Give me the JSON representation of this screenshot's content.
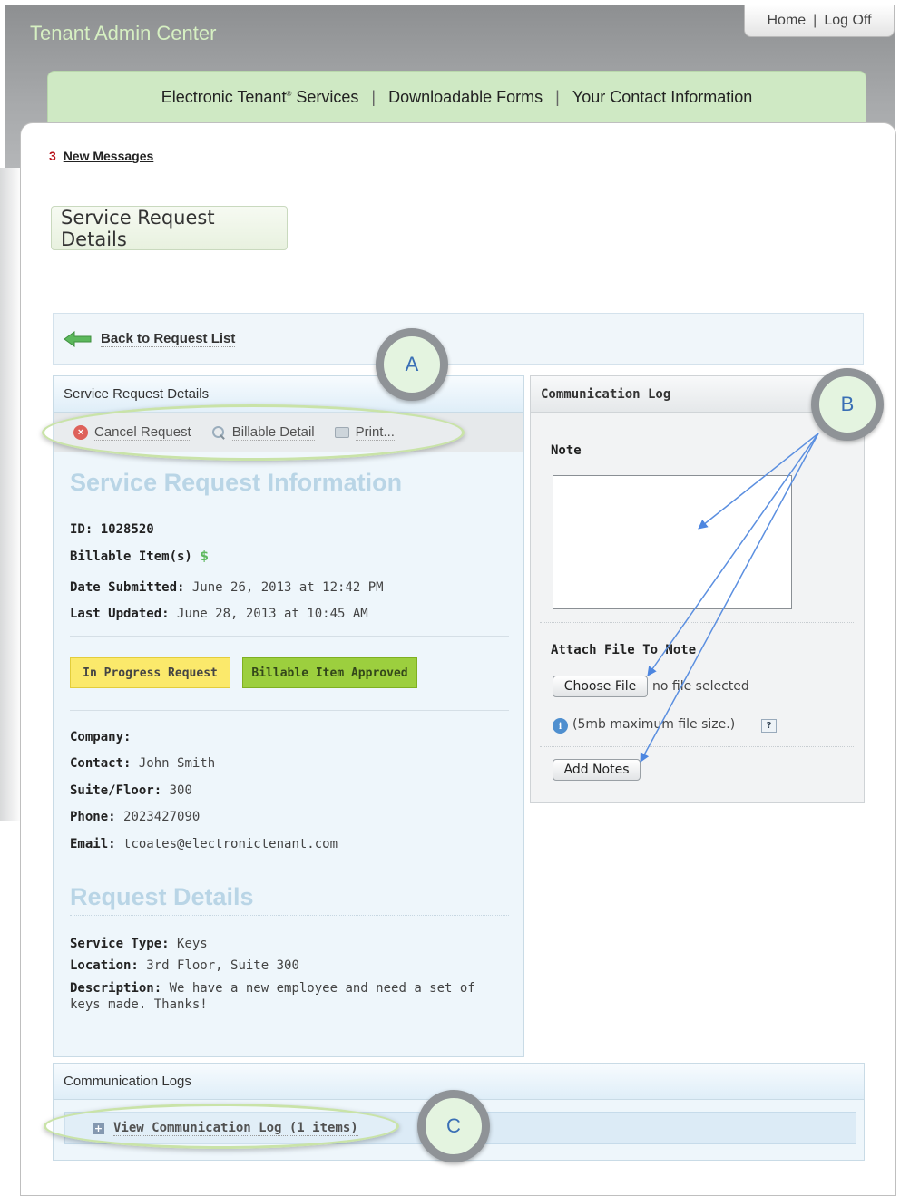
{
  "app": {
    "title": "Tenant Admin Center",
    "top_links": {
      "home": "Home",
      "separator": "|",
      "logoff": "Log Off"
    }
  },
  "nav": {
    "items": [
      {
        "label": "Electronic Tenant",
        "sup": "®",
        "suffix": " Services"
      },
      {
        "label": "Downloadable Forms"
      },
      {
        "label": "Your Contact Information"
      }
    ],
    "separator": "|"
  },
  "messages": {
    "count": "3",
    "label": "New Messages"
  },
  "page_title": "Service Request Details",
  "back_link": "Back to Request List",
  "left_panel": {
    "header": "Service Request Details",
    "toolbar": {
      "cancel": "Cancel Request",
      "billable": "Billable Detail",
      "print": "Print..."
    },
    "info_title": "Service Request Information",
    "id_label": "ID:",
    "id_value": "1028520",
    "billable_label": "Billable Item(s)",
    "billable_icon": "$",
    "submitted_label": "Date Submitted:",
    "submitted_value": "June 26, 2013 at 12:42 PM",
    "updated_label": "Last Updated:",
    "updated_value": "June 28, 2013 at 10:45 AM",
    "status_badge": "In Progress Request",
    "billable_badge": "Billable Item Approved",
    "company_label": "Company:",
    "company_value": "",
    "contact_label": "Contact:",
    "contact_value": "John Smith",
    "suite_label": "Suite/Floor:",
    "suite_value": "300",
    "phone_label": "Phone:",
    "phone_value": "2023427090",
    "email_label": "Email:",
    "email_value": "tcoates@electronictenant.com",
    "details_title": "Request Details",
    "service_type_label": "Service Type:",
    "service_type_value": "Keys",
    "location_label": "Location:",
    "location_value": "3rd Floor, Suite 300",
    "description_label": "Description:",
    "description_value": "We have a new employee and need a set of keys made. Thanks!"
  },
  "right_panel": {
    "header": "Communication Log",
    "note_label": "Note",
    "note_value": "",
    "attach_label": "Attach File To Note",
    "choose_file": "Choose File",
    "no_file": "no file selected",
    "info_icon": "i",
    "file_size": "(5mb maximum file size.)",
    "help_icon": "?",
    "add_notes": "Add Notes"
  },
  "logs": {
    "header": "Communication Logs",
    "expand_icon": "+",
    "view_link": "View Communication Log (1 items)"
  },
  "annotations": {
    "a": "A",
    "b": "B",
    "c": "C"
  },
  "colors": {
    "brand_green": "#cfe9c4",
    "panel_blue": "#eef6fb",
    "status_yellow": "#fbe96b",
    "status_green": "#9ccf3e",
    "alert_red": "#b8121a"
  }
}
